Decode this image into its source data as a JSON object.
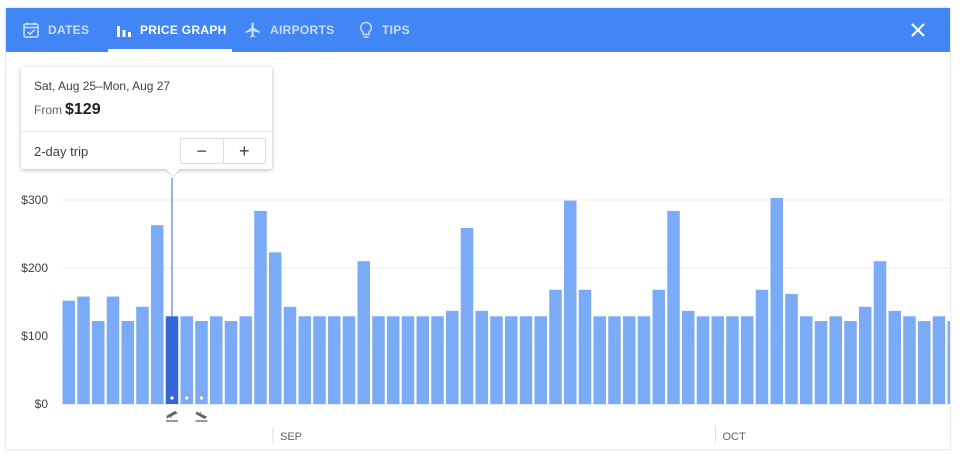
{
  "tabs": [
    {
      "label": "DATES",
      "icon": "calendar-icon",
      "active": false
    },
    {
      "label": "PRICE GRAPH",
      "icon": "bar-chart-icon",
      "active": true
    },
    {
      "label": "AIRPORTS",
      "icon": "airplane-icon",
      "active": false
    },
    {
      "label": "TIPS",
      "icon": "lightbulb-icon",
      "active": false
    }
  ],
  "close_icon": "close-icon",
  "popup": {
    "dates": "Sat, Aug 25–Mon, Aug 27",
    "from_label": "From",
    "price": "$129",
    "trip_length": "2-day trip",
    "minus_label": "−",
    "plus_label": "+"
  },
  "colors": {
    "header": "#4285f4",
    "bar": "#7baaf7",
    "bar_selected": "#3367d6",
    "grid": "#eeeeee"
  },
  "chart_data": {
    "type": "bar",
    "yticks": [
      "$300",
      "$200",
      "$100",
      "$0"
    ],
    "ylim": [
      0,
      300
    ],
    "month_labels": [
      "SEP",
      "OCT"
    ],
    "month_start_indices": [
      14,
      44
    ],
    "selected_index": 7,
    "selected_trip_days": 2,
    "values": [
      152,
      158,
      122,
      158,
      122,
      143,
      263,
      129,
      129,
      122,
      129,
      122,
      129,
      284,
      223,
      143,
      129,
      129,
      129,
      129,
      210,
      129,
      129,
      129,
      129,
      129,
      137,
      259,
      137,
      129,
      129,
      129,
      129,
      168,
      299,
      168,
      129,
      129,
      129,
      129,
      168,
      284,
      137,
      129,
      129,
      129,
      129,
      168,
      303,
      162,
      129,
      122,
      129,
      122,
      143,
      210,
      137,
      129,
      122,
      129,
      122
    ]
  }
}
